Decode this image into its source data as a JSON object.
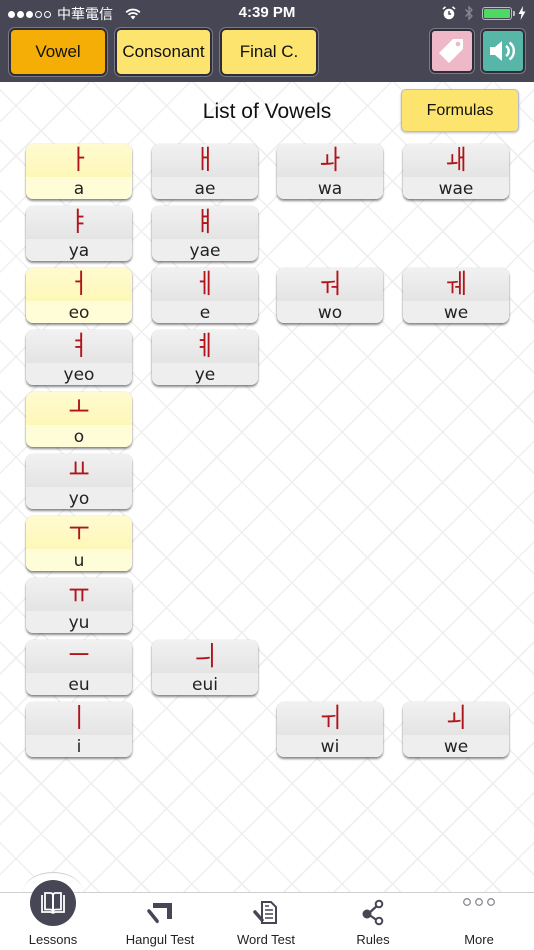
{
  "status_bar": {
    "signal_bars_filled": 3,
    "signal_bars_total": 5,
    "carrier": "中華電信",
    "time": "4:39 PM",
    "battery_color": "#4cd964"
  },
  "top_tabs": [
    {
      "label": "Vowel",
      "active": true
    },
    {
      "label": "Consonant",
      "active": false
    },
    {
      "label": "Final C.",
      "active": false
    }
  ],
  "top_icons": {
    "tag": "tag-icon",
    "sound": "speaker-icon"
  },
  "colors": {
    "header_bg": "#474654",
    "active_tab": "#f5ae05",
    "inactive_tab": "#fde46e",
    "glyph_red": "#b0141a",
    "tag_button": "#eeb8c8",
    "sound_button": "#58b6a8"
  },
  "page": {
    "title": "List of Vowels",
    "formulas_label": "Formulas"
  },
  "vowel_rows": [
    [
      {
        "glyph": "ㅏ",
        "roman": "a",
        "basic": true
      },
      {
        "glyph": "ㅐ",
        "roman": "ae",
        "basic": false
      },
      {
        "glyph": "ㅘ",
        "roman": "wa",
        "basic": false
      },
      {
        "glyph": "ㅙ",
        "roman": "wae",
        "basic": false
      }
    ],
    [
      {
        "glyph": "ㅑ",
        "roman": "ya",
        "basic": false
      },
      {
        "glyph": "ㅒ",
        "roman": "yae",
        "basic": false
      },
      null,
      null
    ],
    [
      {
        "glyph": "ㅓ",
        "roman": "eo",
        "basic": true
      },
      {
        "glyph": "ㅔ",
        "roman": "e",
        "basic": false
      },
      {
        "glyph": "ㅝ",
        "roman": "wo",
        "basic": false
      },
      {
        "glyph": "ㅞ",
        "roman": "we",
        "basic": false
      }
    ],
    [
      {
        "glyph": "ㅕ",
        "roman": "yeo",
        "basic": false
      },
      {
        "glyph": "ㅖ",
        "roman": "ye",
        "basic": false
      },
      null,
      null
    ],
    [
      {
        "glyph": "ㅗ",
        "roman": "o",
        "basic": true
      },
      null,
      null,
      null
    ],
    [
      {
        "glyph": "ㅛ",
        "roman": "yo",
        "basic": false
      },
      null,
      null,
      null
    ],
    [
      {
        "glyph": "ㅜ",
        "roman": "u",
        "basic": true
      },
      null,
      null,
      null
    ],
    [
      {
        "glyph": "ㅠ",
        "roman": "yu",
        "basic": false
      },
      null,
      null,
      null
    ],
    [
      {
        "glyph": "ㅡ",
        "roman": "eu",
        "basic": false
      },
      {
        "glyph": "ㅢ",
        "roman": "eui",
        "basic": false
      },
      null,
      null
    ],
    [
      {
        "glyph": "ㅣ",
        "roman": "i",
        "basic": false
      },
      null,
      {
        "glyph": "ㅟ",
        "roman": "wi",
        "basic": false
      },
      {
        "glyph": "ㅚ",
        "roman": "we",
        "basic": false
      }
    ]
  ],
  "bottom_nav": [
    {
      "label": "Lessons",
      "icon": "book-icon",
      "active": true
    },
    {
      "label": "Hangul Test",
      "icon": "pencil-corner-icon",
      "active": false
    },
    {
      "label": "Word Test",
      "icon": "pencil-document-icon",
      "active": false
    },
    {
      "label": "Rules",
      "icon": "share-nodes-icon",
      "active": false
    },
    {
      "label": "More",
      "icon": "more-dots-icon",
      "active": false
    }
  ]
}
